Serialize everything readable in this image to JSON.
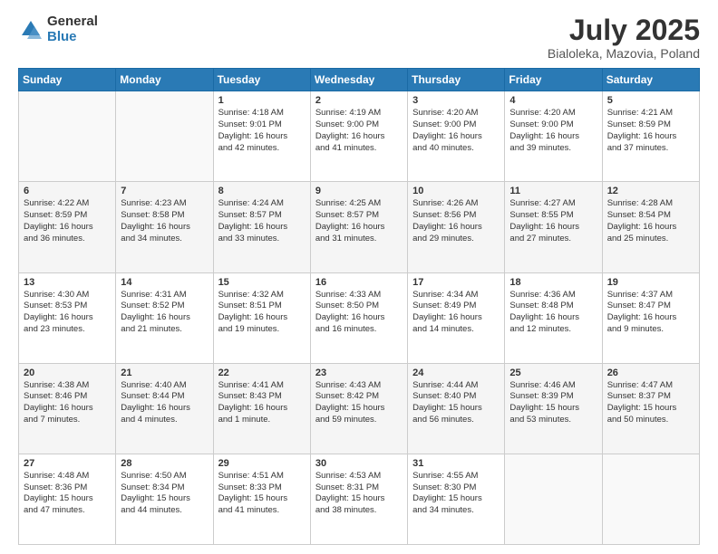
{
  "logo": {
    "general": "General",
    "blue": "Blue"
  },
  "title": "July 2025",
  "subtitle": "Bialoleka, Mazovia, Poland",
  "headers": [
    "Sunday",
    "Monday",
    "Tuesday",
    "Wednesday",
    "Thursday",
    "Friday",
    "Saturday"
  ],
  "weeks": [
    [
      {
        "day": "",
        "text": ""
      },
      {
        "day": "",
        "text": ""
      },
      {
        "day": "1",
        "text": "Sunrise: 4:18 AM\nSunset: 9:01 PM\nDaylight: 16 hours\nand 42 minutes."
      },
      {
        "day": "2",
        "text": "Sunrise: 4:19 AM\nSunset: 9:00 PM\nDaylight: 16 hours\nand 41 minutes."
      },
      {
        "day": "3",
        "text": "Sunrise: 4:20 AM\nSunset: 9:00 PM\nDaylight: 16 hours\nand 40 minutes."
      },
      {
        "day": "4",
        "text": "Sunrise: 4:20 AM\nSunset: 9:00 PM\nDaylight: 16 hours\nand 39 minutes."
      },
      {
        "day": "5",
        "text": "Sunrise: 4:21 AM\nSunset: 8:59 PM\nDaylight: 16 hours\nand 37 minutes."
      }
    ],
    [
      {
        "day": "6",
        "text": "Sunrise: 4:22 AM\nSunset: 8:59 PM\nDaylight: 16 hours\nand 36 minutes."
      },
      {
        "day": "7",
        "text": "Sunrise: 4:23 AM\nSunset: 8:58 PM\nDaylight: 16 hours\nand 34 minutes."
      },
      {
        "day": "8",
        "text": "Sunrise: 4:24 AM\nSunset: 8:57 PM\nDaylight: 16 hours\nand 33 minutes."
      },
      {
        "day": "9",
        "text": "Sunrise: 4:25 AM\nSunset: 8:57 PM\nDaylight: 16 hours\nand 31 minutes."
      },
      {
        "day": "10",
        "text": "Sunrise: 4:26 AM\nSunset: 8:56 PM\nDaylight: 16 hours\nand 29 minutes."
      },
      {
        "day": "11",
        "text": "Sunrise: 4:27 AM\nSunset: 8:55 PM\nDaylight: 16 hours\nand 27 minutes."
      },
      {
        "day": "12",
        "text": "Sunrise: 4:28 AM\nSunset: 8:54 PM\nDaylight: 16 hours\nand 25 minutes."
      }
    ],
    [
      {
        "day": "13",
        "text": "Sunrise: 4:30 AM\nSunset: 8:53 PM\nDaylight: 16 hours\nand 23 minutes."
      },
      {
        "day": "14",
        "text": "Sunrise: 4:31 AM\nSunset: 8:52 PM\nDaylight: 16 hours\nand 21 minutes."
      },
      {
        "day": "15",
        "text": "Sunrise: 4:32 AM\nSunset: 8:51 PM\nDaylight: 16 hours\nand 19 minutes."
      },
      {
        "day": "16",
        "text": "Sunrise: 4:33 AM\nSunset: 8:50 PM\nDaylight: 16 hours\nand 16 minutes."
      },
      {
        "day": "17",
        "text": "Sunrise: 4:34 AM\nSunset: 8:49 PM\nDaylight: 16 hours\nand 14 minutes."
      },
      {
        "day": "18",
        "text": "Sunrise: 4:36 AM\nSunset: 8:48 PM\nDaylight: 16 hours\nand 12 minutes."
      },
      {
        "day": "19",
        "text": "Sunrise: 4:37 AM\nSunset: 8:47 PM\nDaylight: 16 hours\nand 9 minutes."
      }
    ],
    [
      {
        "day": "20",
        "text": "Sunrise: 4:38 AM\nSunset: 8:46 PM\nDaylight: 16 hours\nand 7 minutes."
      },
      {
        "day": "21",
        "text": "Sunrise: 4:40 AM\nSunset: 8:44 PM\nDaylight: 16 hours\nand 4 minutes."
      },
      {
        "day": "22",
        "text": "Sunrise: 4:41 AM\nSunset: 8:43 PM\nDaylight: 16 hours\nand 1 minute."
      },
      {
        "day": "23",
        "text": "Sunrise: 4:43 AM\nSunset: 8:42 PM\nDaylight: 15 hours\nand 59 minutes."
      },
      {
        "day": "24",
        "text": "Sunrise: 4:44 AM\nSunset: 8:40 PM\nDaylight: 15 hours\nand 56 minutes."
      },
      {
        "day": "25",
        "text": "Sunrise: 4:46 AM\nSunset: 8:39 PM\nDaylight: 15 hours\nand 53 minutes."
      },
      {
        "day": "26",
        "text": "Sunrise: 4:47 AM\nSunset: 8:37 PM\nDaylight: 15 hours\nand 50 minutes."
      }
    ],
    [
      {
        "day": "27",
        "text": "Sunrise: 4:48 AM\nSunset: 8:36 PM\nDaylight: 15 hours\nand 47 minutes."
      },
      {
        "day": "28",
        "text": "Sunrise: 4:50 AM\nSunset: 8:34 PM\nDaylight: 15 hours\nand 44 minutes."
      },
      {
        "day": "29",
        "text": "Sunrise: 4:51 AM\nSunset: 8:33 PM\nDaylight: 15 hours\nand 41 minutes."
      },
      {
        "day": "30",
        "text": "Sunrise: 4:53 AM\nSunset: 8:31 PM\nDaylight: 15 hours\nand 38 minutes."
      },
      {
        "day": "31",
        "text": "Sunrise: 4:55 AM\nSunset: 8:30 PM\nDaylight: 15 hours\nand 34 minutes."
      },
      {
        "day": "",
        "text": ""
      },
      {
        "day": "",
        "text": ""
      }
    ]
  ]
}
